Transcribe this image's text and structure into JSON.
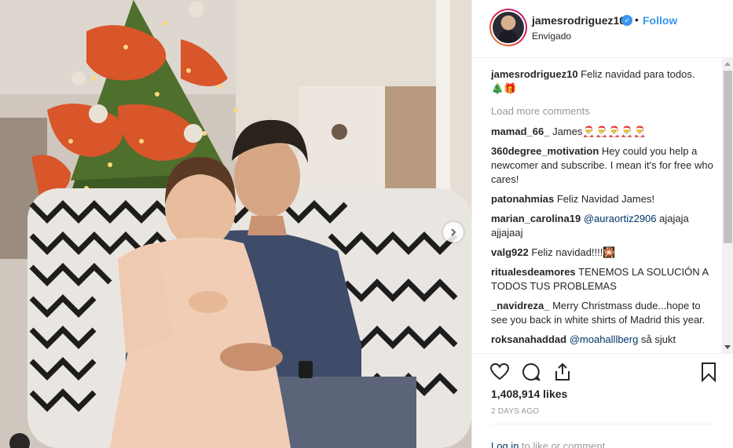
{
  "header": {
    "username": "jamesrodriguez10",
    "separator": "•",
    "follow_label": "Follow",
    "location": "Envigado"
  },
  "caption": {
    "username": "jamesrodriguez10",
    "text": "Feliz navidad para todos.",
    "emoji": "🎄🎁"
  },
  "load_more_label": "Load more comments",
  "comments": [
    {
      "user": "mamad_66_",
      "text": "James🎅🎅🎅🎅🎅"
    },
    {
      "user": "360degree_motivation",
      "text": "Hey could you help a newcomer and subscribe. I mean it's for free who cares!"
    },
    {
      "user": "patonahmias",
      "text": "Feliz Navidad James!"
    },
    {
      "user": "marian_carolina19",
      "mention": "@auraortiz2906",
      "text": "ajajaja ajjajaaj"
    },
    {
      "user": "valg922",
      "text": "Feliz navidad!!!!🎇"
    },
    {
      "user": "ritualesdeamores",
      "text": "TENEMOS LA SOLUCIÓN A TODOS TUS PROBLEMAS"
    },
    {
      "user": "_navidreza_",
      "text": "Merry Christmass dude...hope to see you back in white shirts of Madrid this year."
    },
    {
      "user": "roksanahaddad",
      "mention": "@moahalllberg",
      "text": "så sjukt"
    }
  ],
  "likes": "1,408,914 likes",
  "time_ago": "2 DAYS AGO",
  "login_prompt": {
    "login": "Log in",
    "rest": "to like or comment."
  },
  "icons": {
    "like": "heart-icon",
    "comment": "comment-icon",
    "share": "share-icon",
    "save": "bookmark-icon",
    "next": "chevron-right-icon",
    "verified": "verified-badge-icon"
  },
  "colors": {
    "link_blue": "#3897f0",
    "text": "#262626",
    "muted": "#999999"
  }
}
